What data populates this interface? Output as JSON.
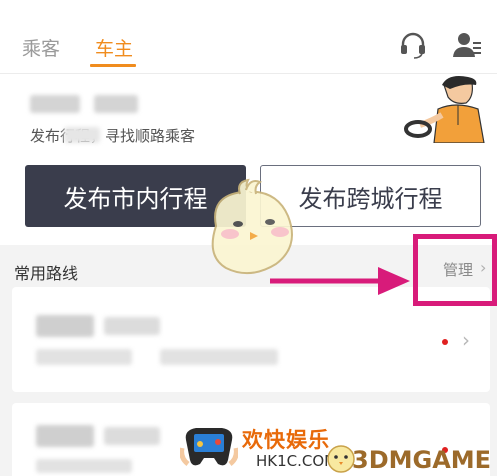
{
  "tabs": [
    {
      "label": "乘客",
      "active": false
    },
    {
      "label": "车主",
      "active": true
    }
  ],
  "header_icons": [
    "headset-icon",
    "profile-icon"
  ],
  "hero": {
    "subtitle": "发布行程，寻找顺路乘客"
  },
  "buttons": {
    "publish_city": "发布市内行程",
    "publish_intercity": "发布跨城行程"
  },
  "routes": {
    "title": "常用路线",
    "manage": "管理",
    "manage_chevron": "›"
  },
  "annotation_color": "#d81b7a",
  "accent_color": "#f08c1e",
  "watermark": {
    "cn": "欢快娱乐",
    "site": "HK1C.COM",
    "brand": "3DMGAME"
  }
}
